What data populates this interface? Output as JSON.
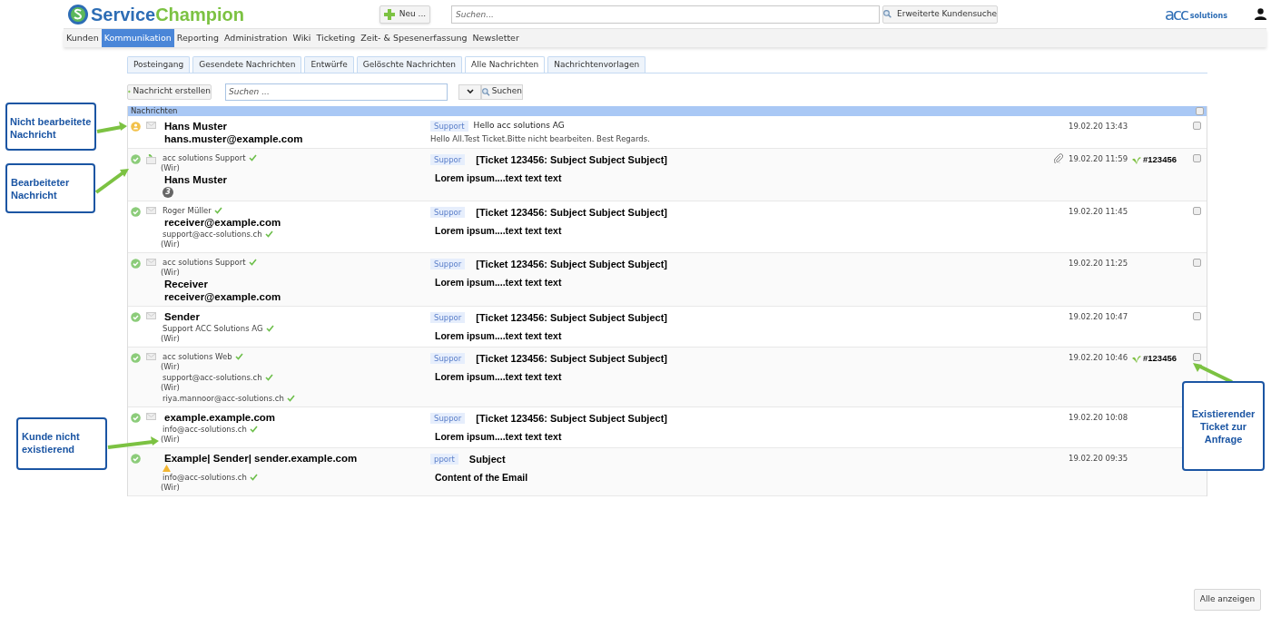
{
  "header": {
    "logo": {
      "first": "Service",
      "second": "Champion"
    },
    "new_button": "Neu ...",
    "search": {
      "placeholder": "Suchen..."
    },
    "advanced_button": "Erweiterte Kundensuche",
    "brand": {
      "mark": "acc",
      "word": "solutions"
    }
  },
  "nav": [
    {
      "label": "Kunden",
      "selected": false
    },
    {
      "label": "Kommunikation",
      "selected": true
    },
    {
      "label": "Reporting",
      "selected": false
    },
    {
      "label": "Administration",
      "selected": false
    },
    {
      "label": "Wiki",
      "selected": false
    },
    {
      "label": "Ticketing",
      "selected": false
    },
    {
      "label": "Zeit- & Spesenerfassung",
      "selected": false
    },
    {
      "label": "Newsletter",
      "selected": false
    }
  ],
  "tabs": [
    {
      "label": "Posteingang",
      "selected": false
    },
    {
      "label": "Gesendete Nachrichten",
      "selected": false
    },
    {
      "label": "Entwürfe",
      "selected": false
    },
    {
      "label": "Gelöschte Nachrichten",
      "selected": false
    },
    {
      "label": "Alle Nachrichten",
      "selected": true
    },
    {
      "label": "Nachrichtenvorlagen",
      "selected": false
    }
  ],
  "toolbar": {
    "create_button": "Nachricht erstellen",
    "search": {
      "placeholder": "Suchen ..."
    },
    "search_button": "Suchen"
  },
  "table": {
    "title": "Nachrichten",
    "select_all": {
      "checked": false
    },
    "rows": [
      {
        "icons": [
          {
            "kind": "status_new"
          },
          {
            "kind": "envelope"
          }
        ],
        "kind": "plain",
        "lines": [
          {
            "kind": "bold",
            "text": "Hans Muster"
          },
          {
            "kind": "bold",
            "text": "hans.muster@example.com"
          }
        ],
        "tag": "Support",
        "subject": "Hello acc solutions AG",
        "preview": "Hello All.Test Ticket.Bitte nicht bearbeiten.  Best Regards.",
        "date": "19.02.20 13:43",
        "checked": false
      },
      {
        "icons": [
          {
            "kind": "status_done"
          },
          {
            "kind": "reply"
          }
        ],
        "kind": "ticket",
        "lines": [
          {
            "kind": "name",
            "text": "acc solutions Support",
            "verified": true
          },
          {
            "kind": "note",
            "text": "(Wir)"
          },
          {
            "kind": "bold",
            "text": "Hans Muster"
          },
          {
            "kind": "count",
            "text": "3"
          }
        ],
        "tag": "Suppor",
        "subject": "[Ticket 123456: Subject Subject Subject]",
        "preview": "Lorem ipsum....text text text",
        "attachment": true,
        "date": "19.02.20 11:59",
        "ticket": "#123456",
        "checked": false
      },
      {
        "icons": [
          {
            "kind": "status_done"
          },
          {
            "kind": "envelope"
          }
        ],
        "kind": "ticket",
        "lines": [
          {
            "kind": "name",
            "text": "Roger Müller",
            "verified": true
          },
          {
            "kind": "bold",
            "text": "receiver@example.com"
          },
          {
            "kind": "name",
            "text": "support@acc-solutions.ch",
            "verified": true
          },
          {
            "kind": "note",
            "text": "(Wir)"
          }
        ],
        "tag": "Suppor",
        "subject": "[Ticket 123456: Subject Subject Subject]",
        "preview": "Lorem ipsum....text text text",
        "date": "19.02.20 11:45",
        "checked": false
      },
      {
        "icons": [
          {
            "kind": "status_done"
          },
          {
            "kind": "envelope"
          }
        ],
        "kind": "ticket",
        "lines": [
          {
            "kind": "name",
            "text": "acc solutions Support",
            "verified": true
          },
          {
            "kind": "note",
            "text": "(Wir)"
          },
          {
            "kind": "bold",
            "text": "Receiver"
          },
          {
            "kind": "bold",
            "text": "receiver@example.com"
          }
        ],
        "tag": "Suppor",
        "subject": "[Ticket 123456: Subject Subject Subject]",
        "preview": "Lorem ipsum....text text text",
        "date": "19.02.20 11:25",
        "checked": false
      },
      {
        "icons": [
          {
            "kind": "status_done"
          },
          {
            "kind": "envelope"
          }
        ],
        "kind": "ticket",
        "lines": [
          {
            "kind": "bold",
            "text": "Sender"
          },
          {
            "kind": "name",
            "text": "Support ACC Solutions AG",
            "verified": true
          },
          {
            "kind": "note",
            "text": "(Wir)"
          }
        ],
        "tag": "Suppor",
        "subject": "[Ticket 123456: Subject Subject Subject]",
        "preview": "Lorem ipsum....text text text",
        "date": "19.02.20 10:47",
        "checked": false
      },
      {
        "icons": [
          {
            "kind": "status_done"
          },
          {
            "kind": "envelope"
          }
        ],
        "kind": "ticket",
        "lines": [
          {
            "kind": "name",
            "text": "acc solutions Web",
            "verified": true
          },
          {
            "kind": "note",
            "text": "(Wir)"
          },
          {
            "kind": "name",
            "text": "support@acc-solutions.ch",
            "verified": true
          },
          {
            "kind": "note",
            "text": "(Wir)"
          },
          {
            "kind": "name",
            "text": "riya.mannoor@acc-solutions.ch",
            "verified": true
          }
        ],
        "tag": "Suppor",
        "subject": "[Ticket 123456: Subject Subject Subject]",
        "preview": "Lorem ipsum....text text text",
        "date": "19.02.20 10:46",
        "ticket": "#123456",
        "checked": false
      },
      {
        "icons": [
          {
            "kind": "status_done"
          },
          {
            "kind": "envelope"
          }
        ],
        "kind": "ticket",
        "lines": [
          {
            "kind": "bold",
            "text": "example.example.com"
          },
          {
            "kind": "name",
            "text": "info@acc-solutions.ch",
            "verified": true
          },
          {
            "kind": "note",
            "text": "(Wir)"
          }
        ],
        "tag": "Suppor",
        "subject": "[Ticket 123456: Subject Subject Subject]",
        "preview": "Lorem ipsum....text text text",
        "date": "19.02.20 10:08"
      },
      {
        "icons": [
          {
            "kind": "status_done"
          }
        ],
        "kind": "ticket",
        "lines": [
          {
            "kind": "bold",
            "text": "Example| Sender| sender.example.com"
          },
          {
            "kind": "warning"
          },
          {
            "kind": "name",
            "text": "info@acc-solutions.ch",
            "verified": true
          },
          {
            "kind": "note",
            "text": "(Wir)"
          }
        ],
        "tag": "pport",
        "subject": "Subject",
        "preview": "Content of the Email",
        "date": "19.02.20 09:35"
      }
    ]
  },
  "show_all_button": "Alle anzeigen",
  "callouts": [
    {
      "text": "Nicht bearbeitete Nachricht"
    },
    {
      "text": "Bearbeiteter Nachricht"
    },
    {
      "text": "Kunde nicht existierend"
    },
    {
      "text": "Existierender Ticket zur Anfrage"
    }
  ]
}
